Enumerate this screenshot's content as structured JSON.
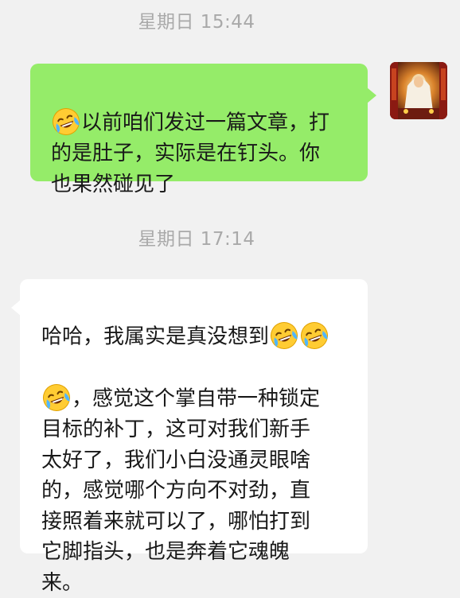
{
  "chat": {
    "timestamp_1": "星期日 15:44",
    "timestamp_2": "星期日 17:14",
    "outgoing_message": {
      "segments": [
        {
          "emoji": "rolling-on-floor-laughing"
        },
        {
          "text": "以前咱们发过一篇文章，打\n的是肚子，实际是在钉头。你\n也果然碰见了"
        }
      ]
    },
    "incoming_message": {
      "segments": [
        {
          "text": "哈哈，我属实是真没想到"
        },
        {
          "emoji": "rolling-on-floor-laughing"
        },
        {
          "emoji": "rolling-on-floor-laughing"
        },
        {
          "text": "\n"
        },
        {
          "emoji": "rolling-on-floor-laughing"
        },
        {
          "text": "，感觉这个掌自带一种锁定\n目标的补丁，这可对我们新手\n太好了，我们小白没通灵眼啥\n的，感觉哪个方向不对劲，直\n接照着来就可以了，哪怕打到\n它脚指头，也是奔着它魂魄\n来。"
        }
      ]
    }
  },
  "colors": {
    "background": "#f1f1f1",
    "outgoing_bubble": "#95ec69",
    "incoming_bubble": "#ffffff",
    "timestamp": "#a9a9a9",
    "text": "#191919"
  }
}
